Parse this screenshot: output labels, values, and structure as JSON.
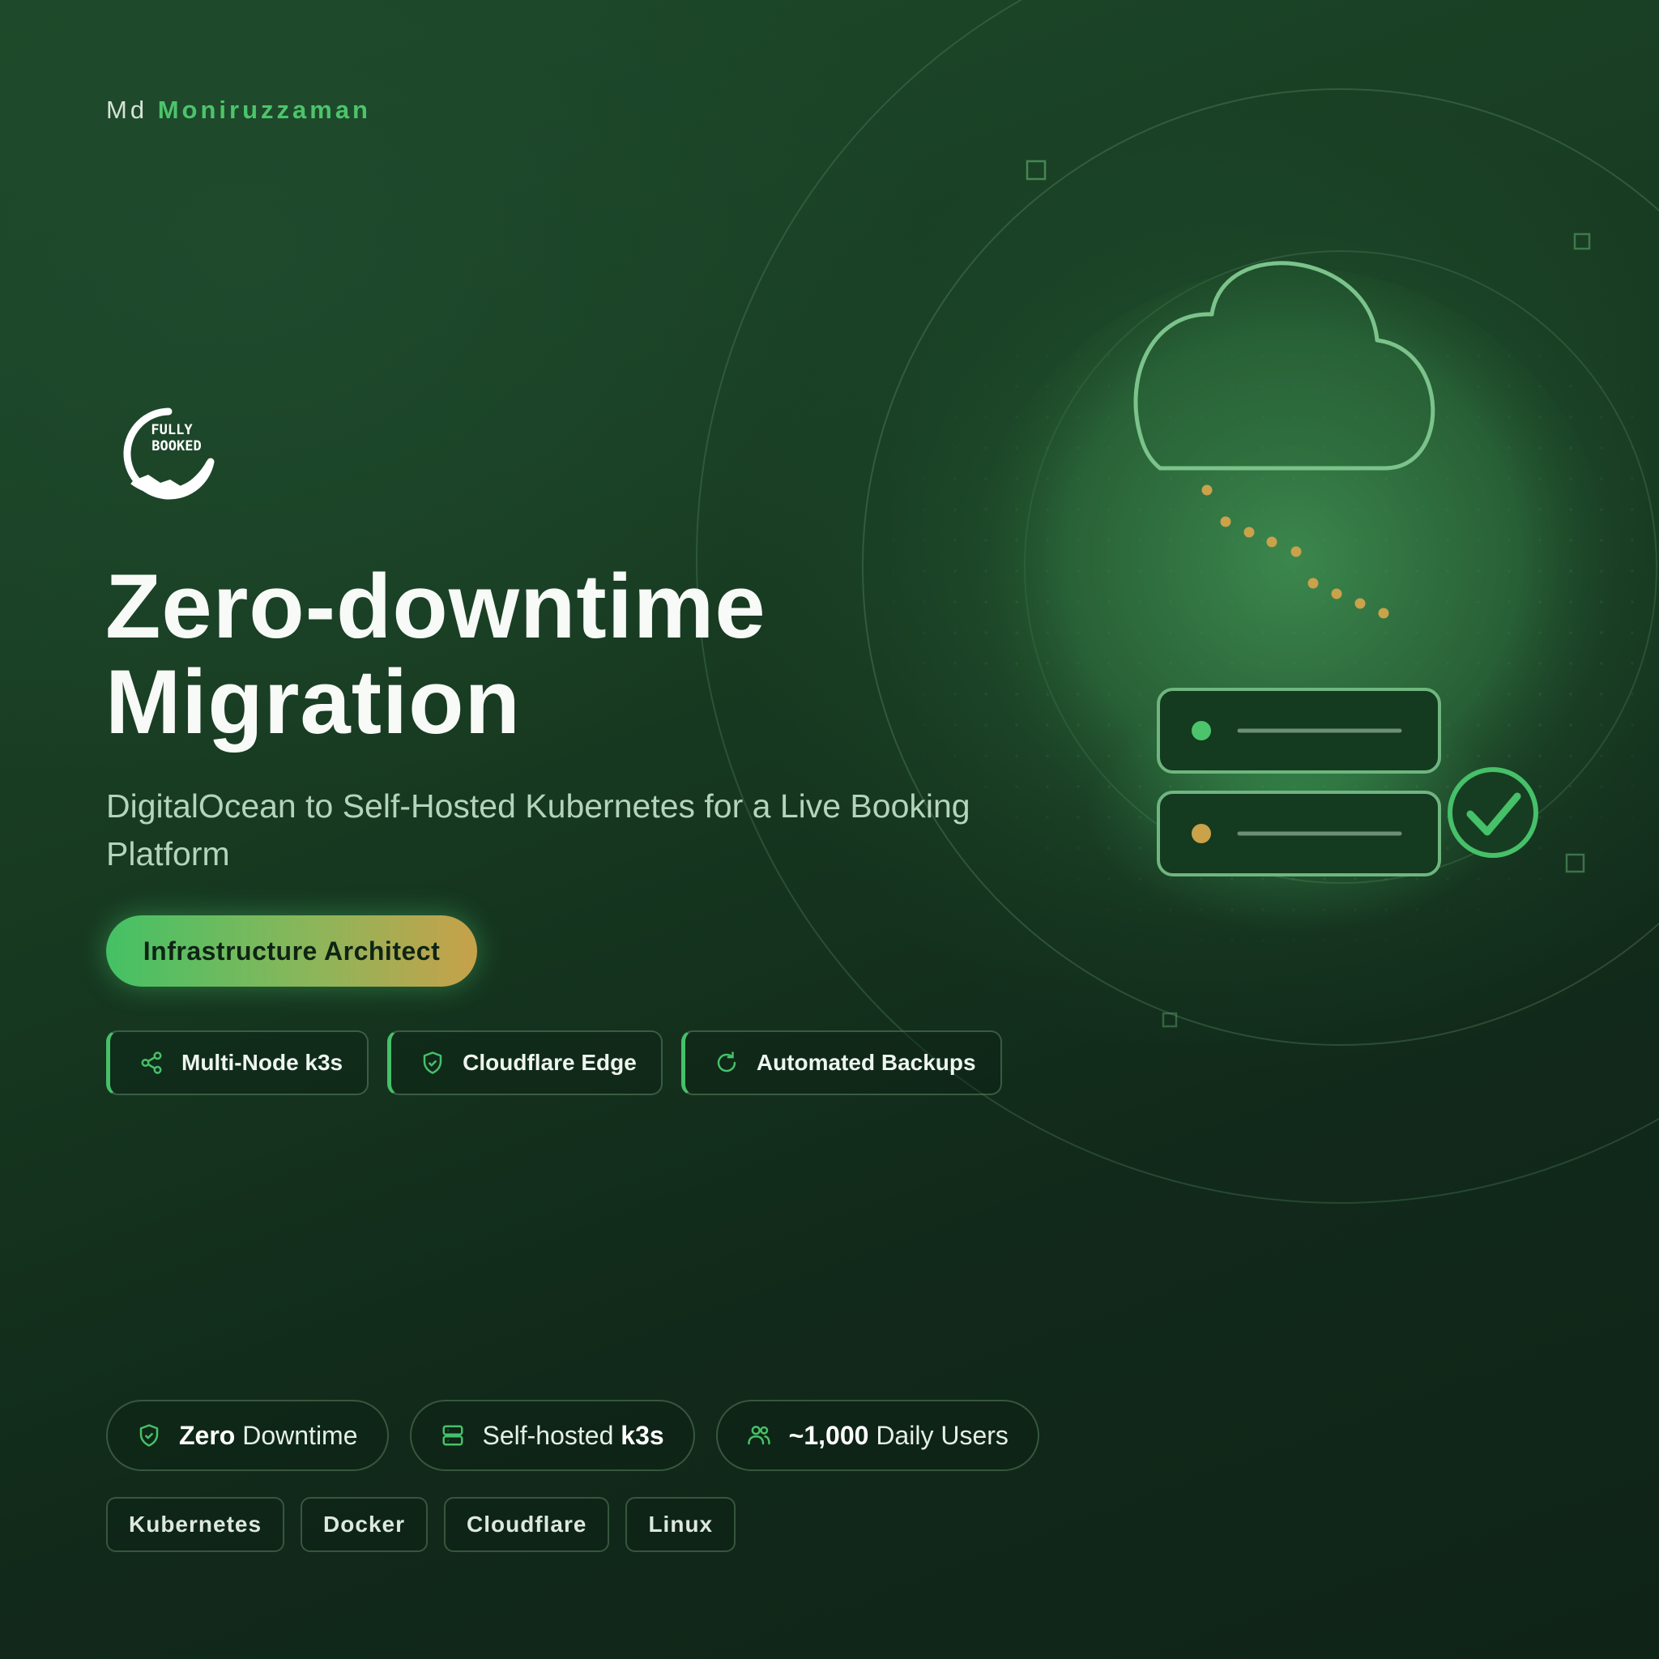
{
  "author": {
    "first": "Md",
    "last": "Moniruzzaman"
  },
  "logo": {
    "text_line1": "FULLY",
    "text_line2": "BOOKED"
  },
  "title": {
    "line1": "Zero-downtime",
    "line2": "Migration"
  },
  "subtitle": "DigitalOcean to Self-Hosted Kubernetes for a Live Booking Platform",
  "role": "Infrastructure Architect",
  "features": [
    {
      "icon": "share-nodes-icon",
      "label": "Multi-Node k3s"
    },
    {
      "icon": "shield-check-icon",
      "label": "Cloudflare Edge"
    },
    {
      "icon": "refresh-icon",
      "label": "Automated Backups"
    }
  ],
  "stats": [
    {
      "icon": "shield-check-icon",
      "bold": "Zero",
      "text": " Downtime"
    },
    {
      "icon": "server-icon",
      "text": "Self-hosted ",
      "bold": "k3s"
    },
    {
      "icon": "users-icon",
      "bold": "~1,000",
      "text": " Daily Users"
    }
  ],
  "tags": [
    "Kubernetes",
    "Docker",
    "Cloudflare",
    "Linux"
  ],
  "colors": {
    "accent_green": "#4cc46b",
    "accent_gold": "#c9a24a",
    "background": "#173a21"
  }
}
